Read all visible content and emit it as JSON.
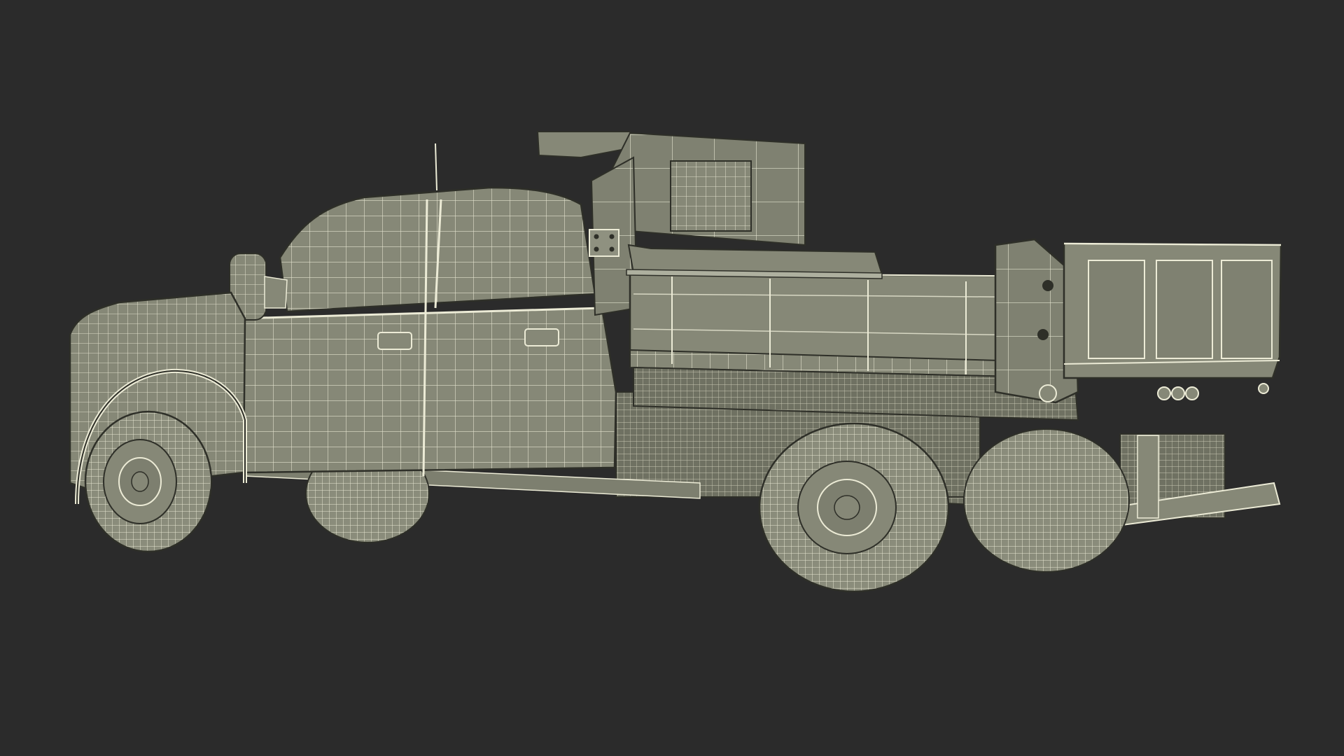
{
  "scene": {
    "subject": "wireframe-dump-truck-model",
    "render_style": "wireframe",
    "background_color": "#2b2b2b",
    "body_color": "#868877",
    "wire_color": "#ecebd6",
    "edge_color": "#2e2f28"
  }
}
